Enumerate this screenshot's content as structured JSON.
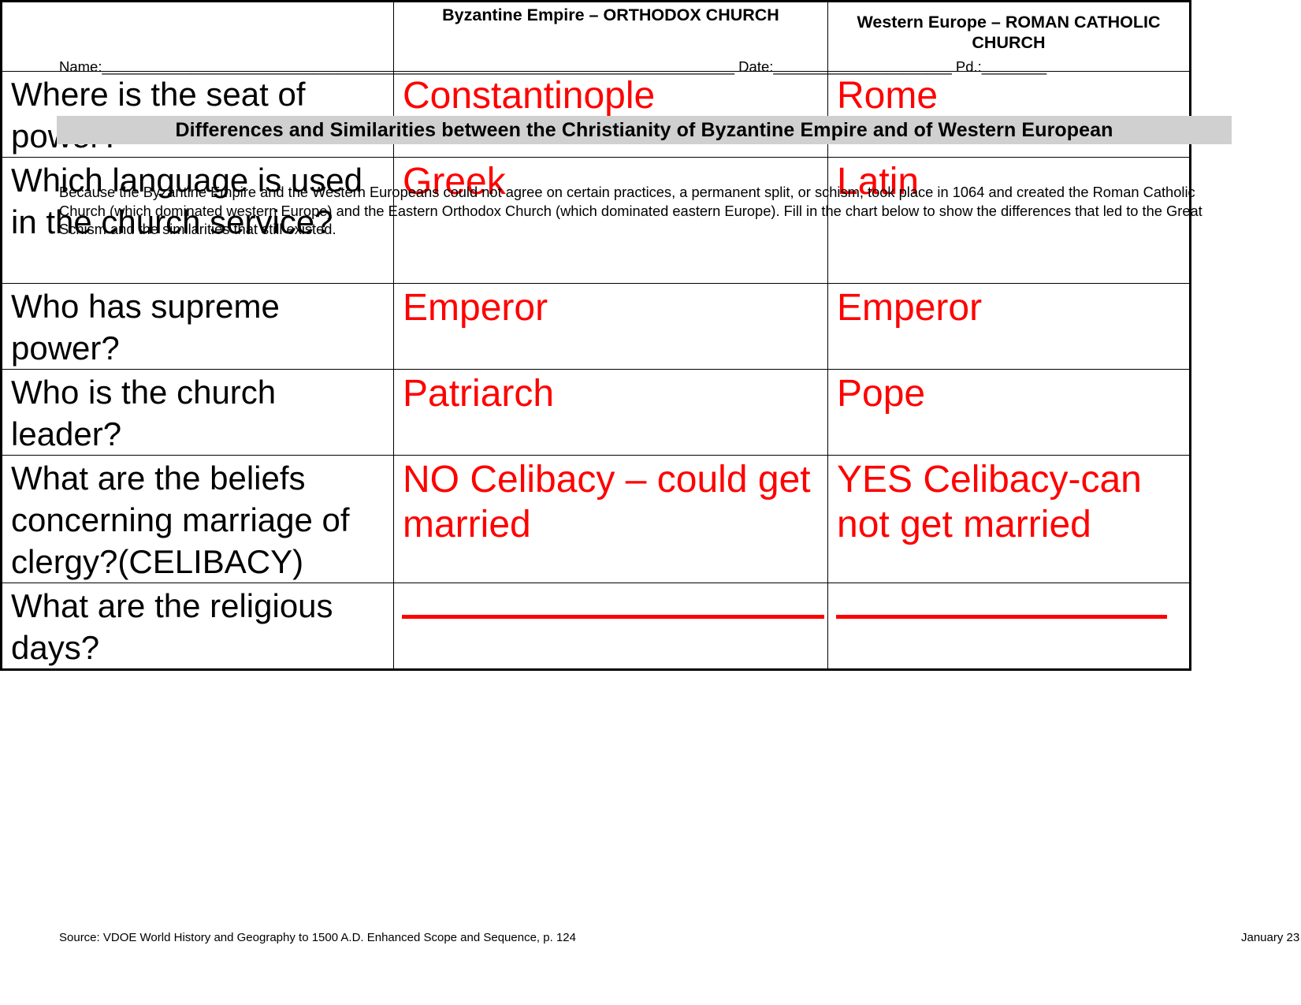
{
  "header": {
    "name_label": "Name:",
    "name_blank": "______________________________________________________________________________",
    "date_label": "Date:",
    "date_blank": "______________________",
    "period_label": "Pd.:",
    "period_blank": "________"
  },
  "title": "Differences and Similarities between the Christianity of Byzantine Empire and of Western European",
  "intro": "Because the Byzantine Empire and the Western Europeans could not agree on certain practices, a permanent split, or schism, took place in 1064 and created the Roman Catholic Church (which dominated western Europe) and the Eastern Orthodox Church (which dominated eastern Europe).  Fill in the chart below to show the differences that led to the Great Schism and the similarities that still existed.",
  "table": {
    "columns": [
      "",
      "Byzantine Empire – ORTHODOX CHURCH",
      "Western Europe – ROMAN CATHOLIC CHURCH"
    ],
    "rows": [
      {
        "question": "Where is the seat of power?",
        "byzantine": "Constantinople",
        "western": "Rome"
      },
      {
        "question": "Which language is used in the church service?",
        "byzantine": "Greek",
        "western": "Latin"
      },
      {
        "question": "Who has supreme power?",
        "byzantine": "Emperor",
        "western": "Emperor"
      },
      {
        "question": "Who is the church leader?",
        "byzantine": "Patriarch",
        "western": "Pope"
      },
      {
        "question": "What are the beliefs concerning marriage of clergy?(CELIBACY)",
        "byzantine": "NO Celibacy – could get married",
        "western": "YES Celibacy-can not get married"
      },
      {
        "question": "What are the religious days?",
        "byzantine": "",
        "western": ""
      }
    ]
  },
  "footer": {
    "source": "Source:  VDOE World History and Geography to 1500 A.D. Enhanced Scope and Sequence, p. 124",
    "date": "January 23"
  },
  "colors": {
    "answer": "#ff0000",
    "title_band": "#d0d0d0"
  }
}
